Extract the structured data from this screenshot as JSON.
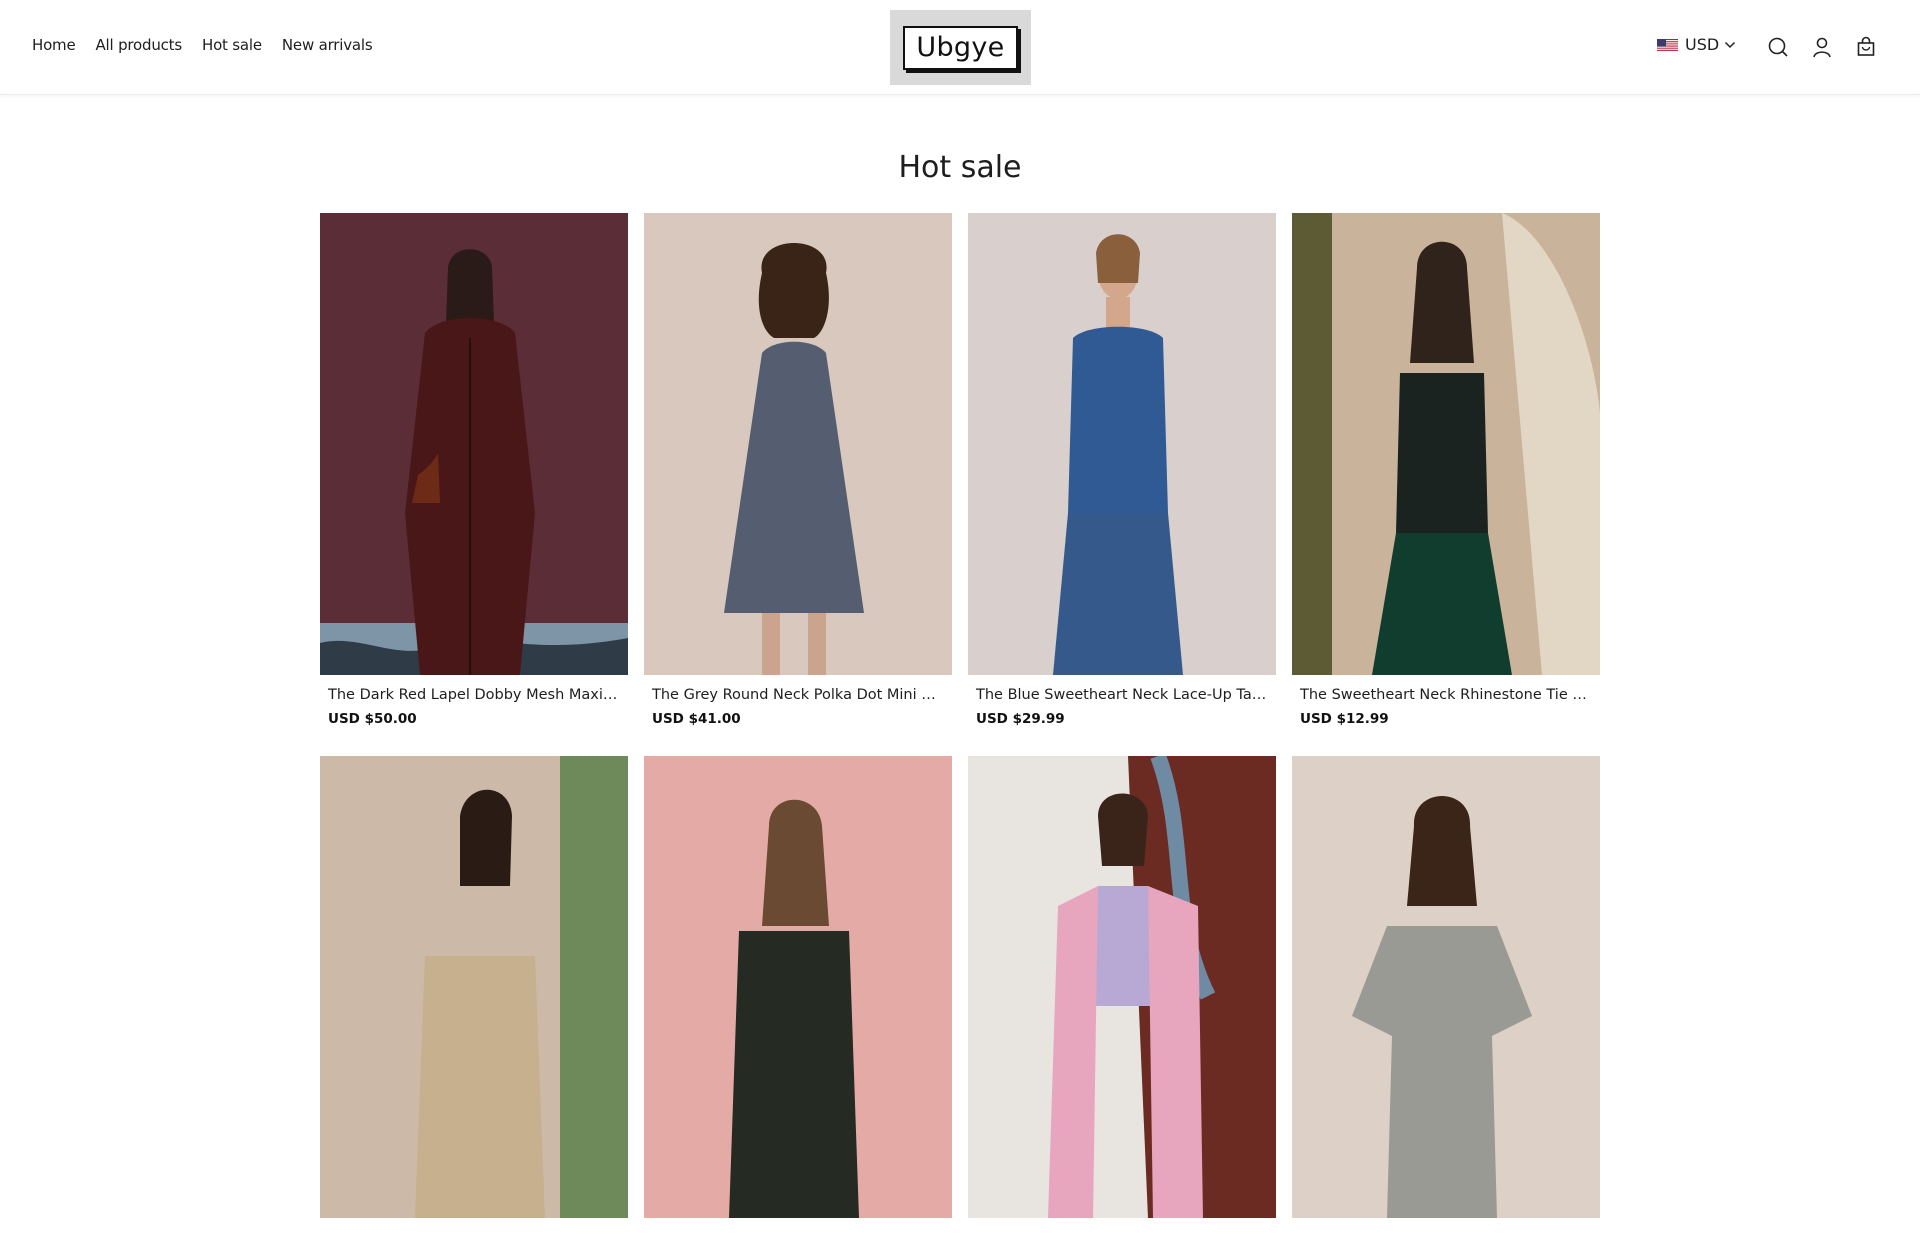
{
  "header": {
    "nav": [
      "Home",
      "All products",
      "Hot sale",
      "New arrivals"
    ],
    "logo_text": "Ubgye",
    "currency": "USD",
    "icons": [
      "search-icon",
      "account-icon",
      "cart-icon"
    ]
  },
  "page": {
    "title": "Hot sale"
  },
  "products": [
    {
      "title": "The Dark Red Lapel Dobby Mesh Maxi D...",
      "price": "USD $50.00"
    },
    {
      "title": "The Grey Round Neck Polka Dot Mini Dr...",
      "price": "USD $41.00"
    },
    {
      "title": "The Blue Sweetheart Neck Lace-Up Tan...",
      "price": "USD $29.99"
    },
    {
      "title": "The Sweetheart Neck Rhinestone Tie Str...",
      "price": "USD $12.99"
    },
    {
      "title": "",
      "price": ""
    },
    {
      "title": "",
      "price": ""
    },
    {
      "title": "",
      "price": ""
    },
    {
      "title": "",
      "price": ""
    }
  ],
  "colors": {
    "text": "#1e1e1e",
    "logo_bg": "#d9d9d9"
  }
}
